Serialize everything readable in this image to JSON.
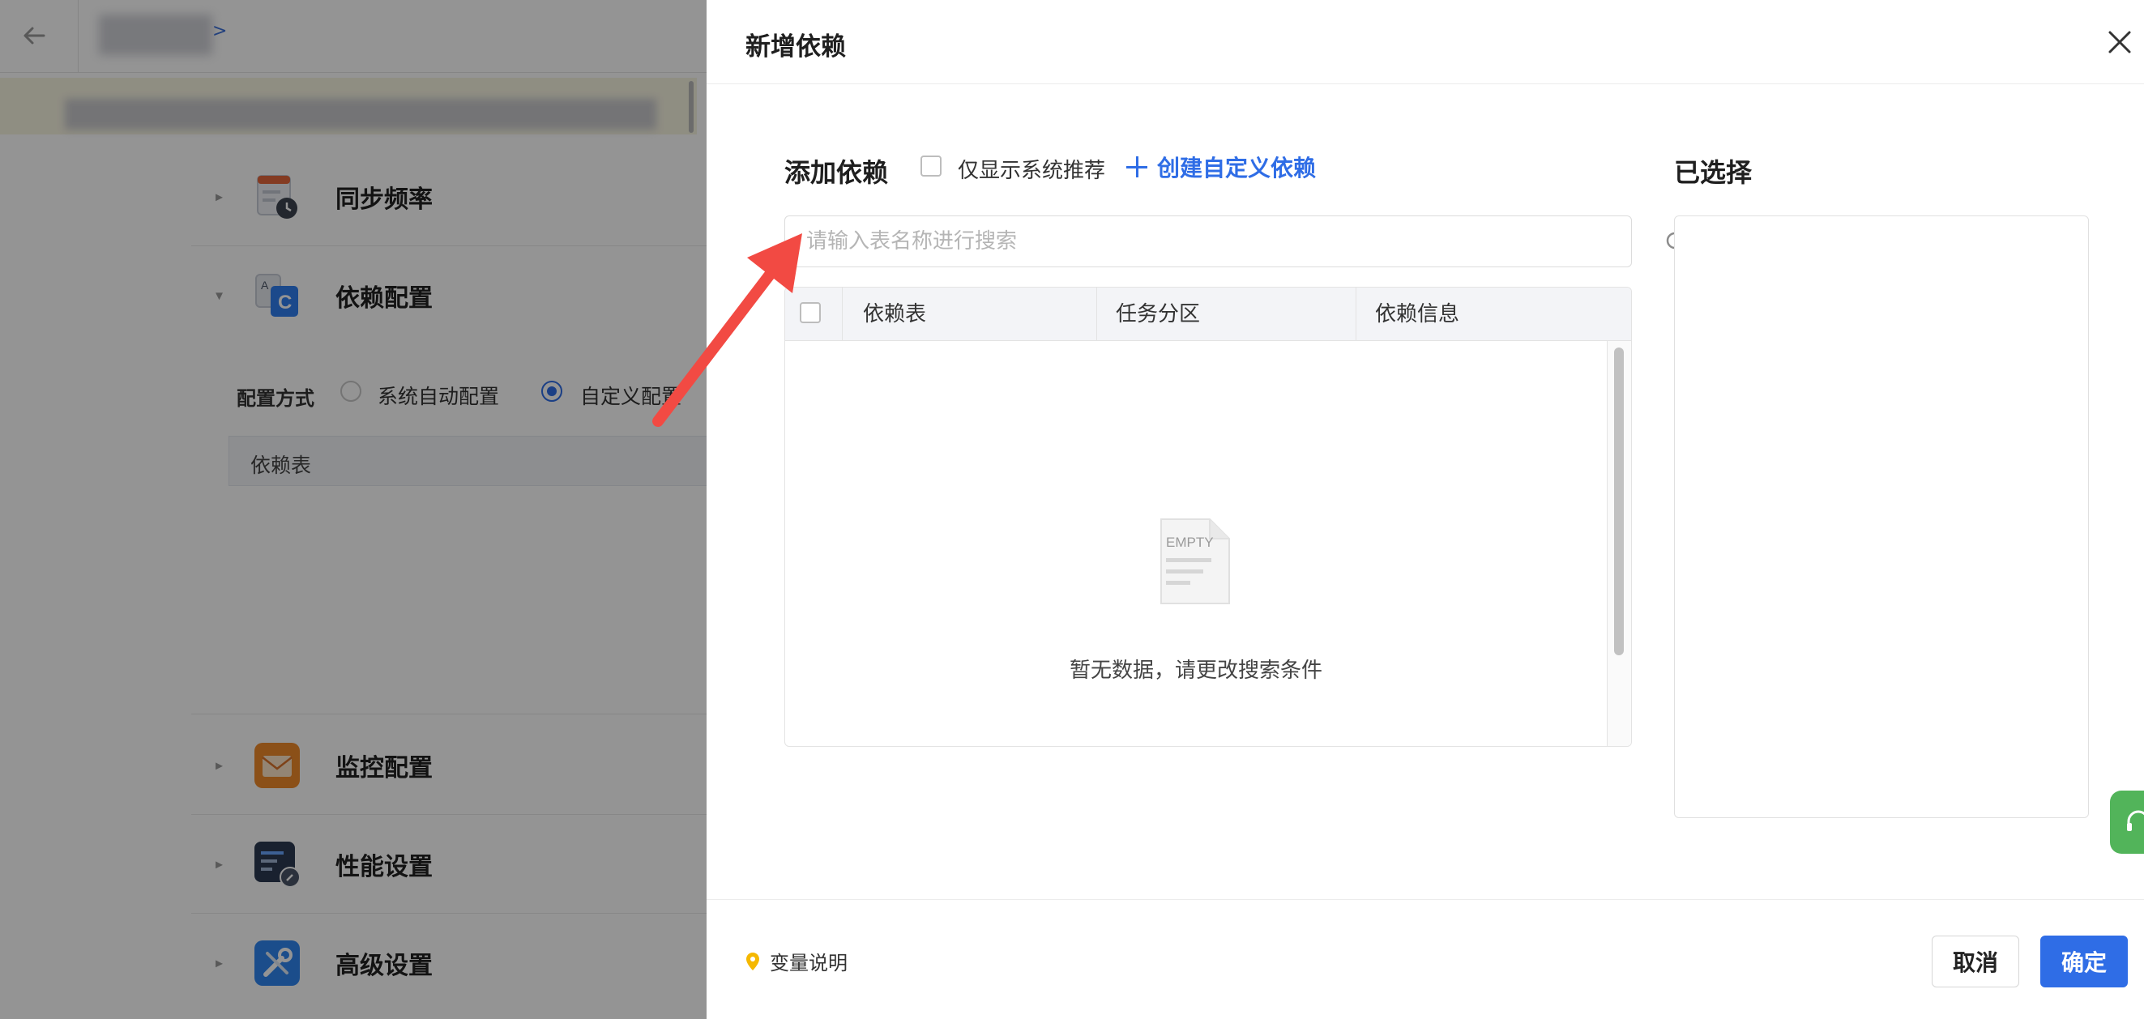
{
  "background": {
    "breadcrumb_link": ">",
    "sections": [
      {
        "title": "同步频率",
        "icon": "calendar-clock-icon"
      },
      {
        "title": "依赖配置",
        "icon": "dependency-icon"
      },
      {
        "title": "监控配置",
        "icon": "mail-icon"
      },
      {
        "title": "性能设置",
        "icon": "performance-icon"
      },
      {
        "title": "高级设置",
        "icon": "tools-icon"
      }
    ],
    "config_label": "配置方式",
    "radio_options": [
      "系统自动配置",
      "自定义配置"
    ],
    "radio_selected": "自定义配置",
    "table_header": "依赖表"
  },
  "drawer": {
    "title": "新增依赖",
    "add_section_title": "添加依赖",
    "only_system_label": "仅显示系统推荐",
    "create_custom_label": "创建自定义依赖",
    "search_placeholder": "请输入表名称进行搜索",
    "columns": [
      "依赖表",
      "任务分区",
      "依赖信息"
    ],
    "empty_icon_text": "EMPTY",
    "empty_text": "暂无数据，请更改搜索条件",
    "selected_section_title": "已选择",
    "footer": {
      "var_help_label": "变量说明",
      "cancel_label": "取消",
      "ok_label": "确定"
    }
  },
  "colors": {
    "accent": "#2f6de6",
    "help_tab": "#52b45a",
    "annotation_arrow": "#f24a43"
  }
}
